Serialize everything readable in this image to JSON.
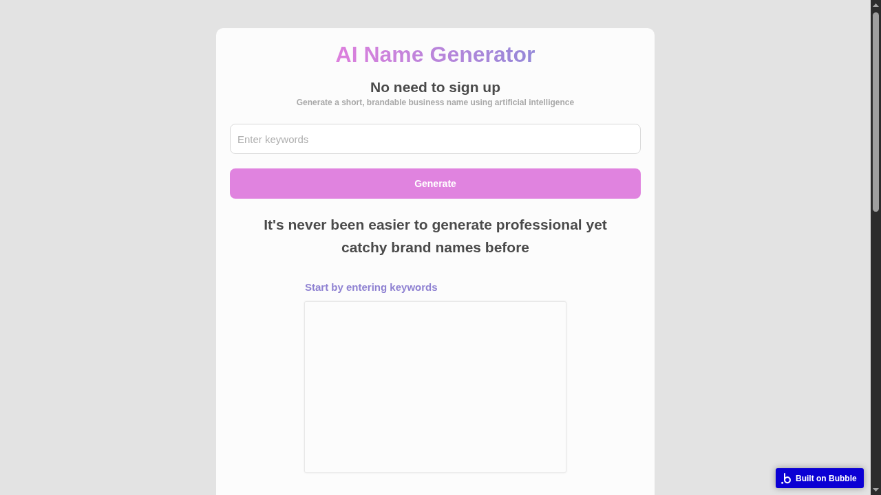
{
  "header": {
    "title": "AI Name Generator",
    "subtitle": "No need to sign up",
    "description": "Generate a short, brandable business name using artificial intelligence"
  },
  "keywords_field": {
    "placeholder": "Enter keywords"
  },
  "generate_button": {
    "label": "Generate"
  },
  "tagline": "It's never been easier to generate professional yet catchy brand names before",
  "results": {
    "label": "Start by entering keywords"
  },
  "badge": {
    "label": "Built on Bubble"
  }
}
